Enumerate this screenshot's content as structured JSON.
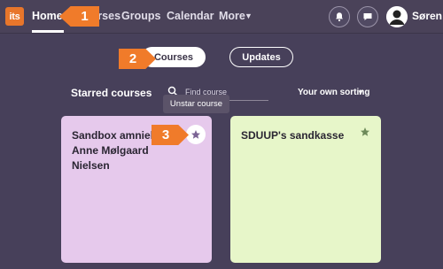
{
  "header": {
    "logo_text": "its",
    "nav": {
      "home": "Home",
      "courses": "Courses",
      "groups": "Groups",
      "calendar": "Calendar",
      "more": "More"
    },
    "user_name": "Søren",
    "icons": [
      "bell-icon",
      "chat-icon",
      "avatar"
    ]
  },
  "toggle": {
    "courses": "Courses",
    "updates": "Updates"
  },
  "filter": {
    "title": "Starred courses",
    "search_placeholder": "Find course",
    "sorting": "Your own sorting"
  },
  "tooltip": "Unstar course",
  "cards": [
    {
      "title": "Sandbox amnielse Anne Mølgaard Nielsen",
      "color": "#e6c9ec",
      "starred": true
    },
    {
      "title": "SDUUP's sandkasse",
      "color": "#e7f6c9",
      "starred": true
    }
  ],
  "steps": [
    "1",
    "2",
    "3"
  ],
  "colors": {
    "accent": "#f07b2a",
    "background": "#47405a",
    "star": "#7b6394"
  }
}
